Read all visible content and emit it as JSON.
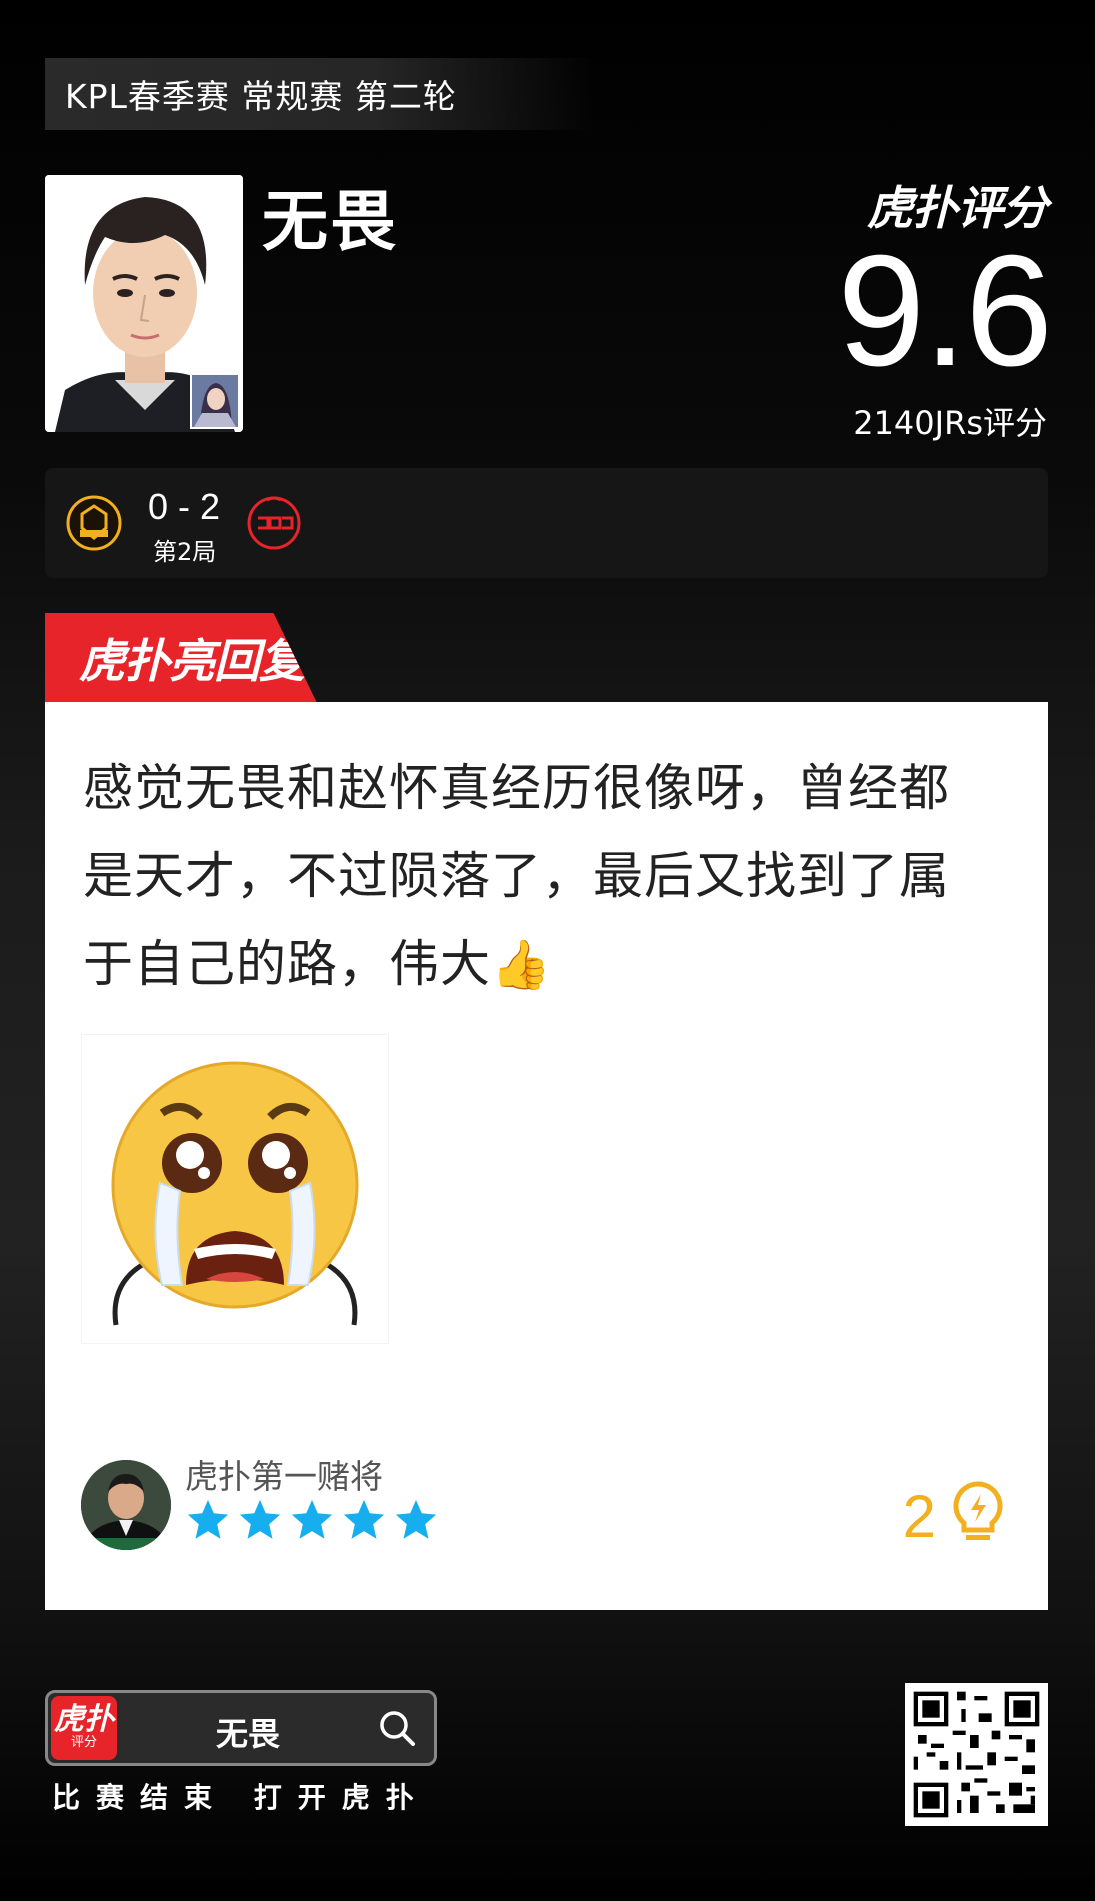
{
  "stage": "KPL春季赛 常规赛 第二轮",
  "player": {
    "name": "无畏"
  },
  "rating": {
    "brand": "虎扑评分",
    "score": "9.6",
    "count": "2140JRs评分"
  },
  "match": {
    "score": "0 - 2",
    "game": "第2局",
    "left_team_icon": "hero-logo-icon",
    "right_team_icon": "jdg-logo-icon",
    "colors": {
      "left": "#f2b01e",
      "right": "#e8242b"
    }
  },
  "highlight_tab": "虎扑亮回复",
  "comment": {
    "text": "感觉无畏和赵怀真经历很像呀，曾经都是天才，不过陨落了，最后又找到了属于自己的路，伟大",
    "emoji_inline": "👍"
  },
  "author": {
    "name": "虎扑第一赌将",
    "stars": 5
  },
  "likes": {
    "count": "2"
  },
  "footer": {
    "app_label_1": "虎扑",
    "app_label_2": "评分",
    "search_text": "无畏",
    "hint": "比赛结束 打开虎扑"
  }
}
